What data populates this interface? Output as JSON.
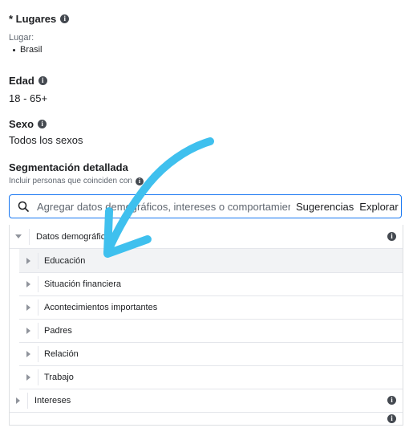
{
  "places": {
    "title": "* Lugares",
    "label": "Lugar:",
    "items": [
      "Brasil"
    ]
  },
  "age": {
    "title": "Edad",
    "value": "18 - 65+"
  },
  "sex": {
    "title": "Sexo",
    "value": "Todos los sexos"
  },
  "detailed": {
    "title": "Segmentación detallada",
    "subtitle": "Incluir personas que coinciden con"
  },
  "search": {
    "placeholder": "Agregar datos demográficos, intereses o comportamient",
    "suggestions": "Sugerencias",
    "explore": "Explorar"
  },
  "tree": {
    "demographics": {
      "label": "Datos demográficos",
      "children": [
        "Educación",
        "Situación financiera",
        "Acontecimientos importantes",
        "Padres",
        "Relación",
        "Trabajo"
      ]
    },
    "interests": {
      "label": "Intereses"
    }
  },
  "colors": {
    "accent": "#1877f2",
    "annotation_arrow": "#3fc0ee",
    "selected_row": "#f2f3f5"
  }
}
